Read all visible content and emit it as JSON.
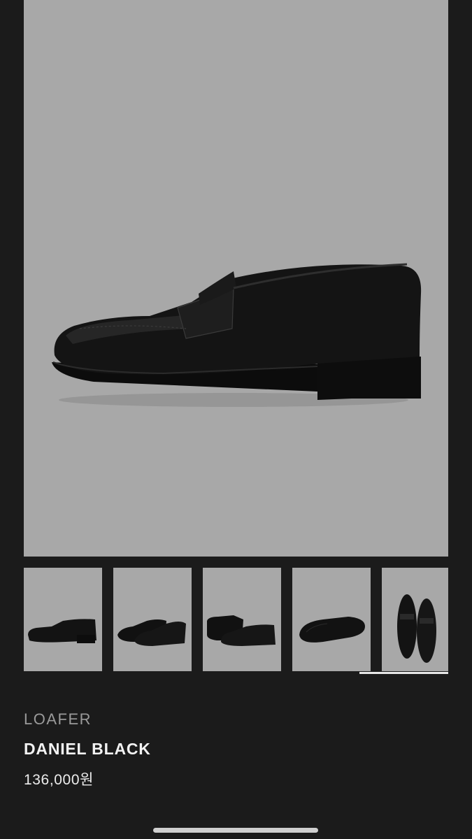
{
  "product": {
    "category": "LOAFER",
    "name": "DANIEL BLACK",
    "price": "136,000원"
  },
  "gallery": {
    "main_image": "black-penny-loafer-side-view",
    "thumbnails": [
      {
        "view": "side"
      },
      {
        "view": "pair-angle"
      },
      {
        "view": "pair-side"
      },
      {
        "view": "sole"
      },
      {
        "view": "pair-top",
        "selected": true
      }
    ]
  },
  "colors": {
    "page_bg": "#1b1b1b",
    "photo_bg": "#a8a8a8",
    "shoe": "#111111"
  }
}
